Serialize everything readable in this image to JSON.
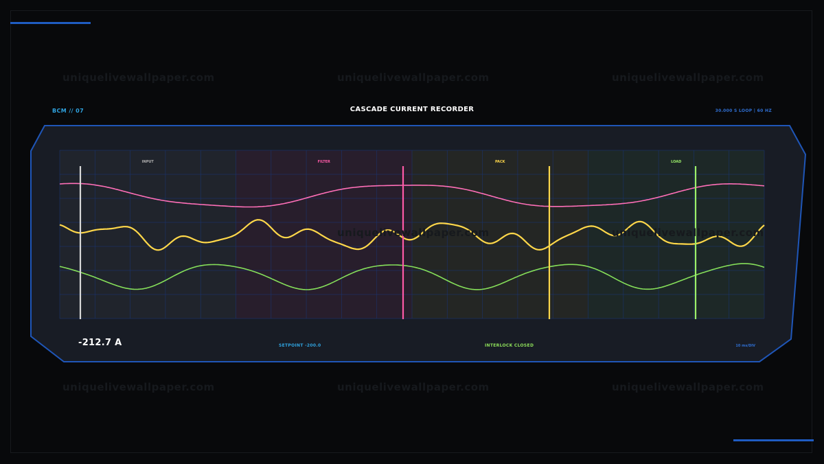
{
  "header": {
    "left_label": "BCM // 07",
    "title": "CASCADE CURRENT RECORDER",
    "right_label": "30.000 S LOOP | 60 HZ"
  },
  "watermark": {
    "text": "uniquelivewallpaper.com"
  },
  "zones": [
    {
      "label": "INPUT",
      "color": "#ffffff",
      "label_color": "#b0b0b0",
      "cursor_color": "#d8d8d8"
    },
    {
      "label": "FILTER",
      "color": "#ff3b8d",
      "label_color": "#ff5aa8",
      "cursor_color": "#ff5aa8"
    },
    {
      "label": "PACK",
      "color": "#ffd21e",
      "label_color": "#ffd84a",
      "cursor_color": "#ffd84a"
    },
    {
      "label": "LOAD",
      "color": "#7ae84d",
      "label_color": "#9cf06a",
      "cursor_color": "#9cf06a"
    }
  ],
  "traces": [
    {
      "name": "pink",
      "color": "#ff6fb8"
    },
    {
      "name": "yellow",
      "color": "#ffd84a"
    },
    {
      "name": "green",
      "color": "#86e05a"
    }
  ],
  "footer": {
    "readout": "-212.7 A",
    "setpoint": "SETPOINT -200.0",
    "interlock": "INTERLOCK CLOSED",
    "scale": "10 ms/DIV"
  },
  "colors": {
    "background": "#08090b",
    "panel_fill": "#181c25",
    "panel_border": "#1f56b8",
    "grid": "#1a3470",
    "accent": "#1f5cc2"
  }
}
